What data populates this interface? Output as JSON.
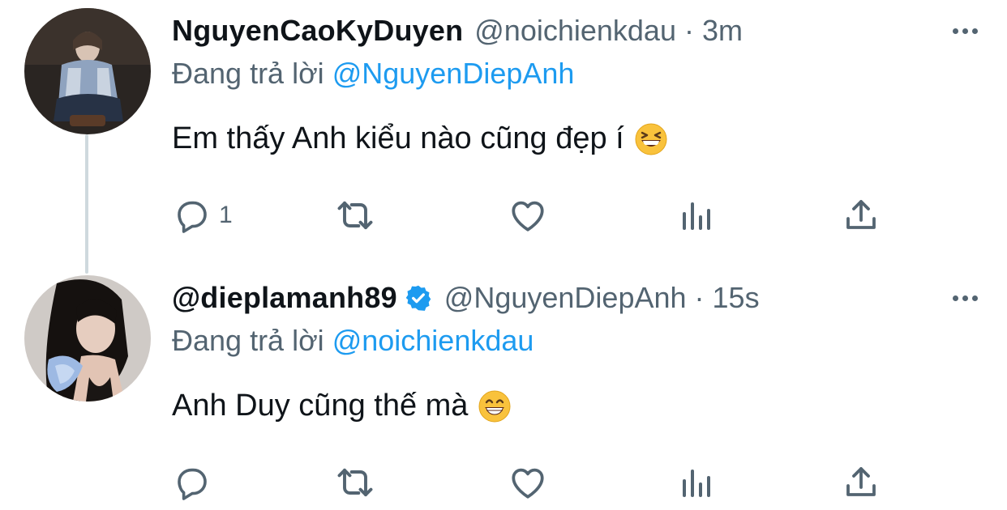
{
  "tweets": [
    {
      "display_name": "NguyenCaoKyDuyen",
      "handle": "@noichienkdau",
      "time": "3m",
      "separator": "·",
      "verified": false,
      "reply_prefix": "Đang trả lời",
      "reply_to": "@NguyenDiepAnh",
      "text": "Em thấy Anh kiểu nào cũng đẹp í",
      "emoji": "grinning-squinting-face",
      "reply_count": "1"
    },
    {
      "display_name": "@dieplamanh89",
      "handle": "@NguyenDiepAnh",
      "time": "15s",
      "separator": "·",
      "verified": true,
      "reply_prefix": "Đang trả lời",
      "reply_to": "@noichienkdau",
      "text": "Anh Duy cũng thế mà",
      "emoji": "beaming-face-with-smiling-eyes",
      "reply_count": ""
    }
  ],
  "icons": {
    "reply": "reply-icon",
    "retweet": "retweet-icon",
    "like": "heart-icon",
    "analytics": "analytics-icon",
    "share": "share-icon",
    "more": "more-icon",
    "verified": "verified-badge-icon"
  },
  "colors": {
    "text_primary": "#0f1419",
    "text_secondary": "#536471",
    "accent": "#1d9bf0",
    "thread_line": "#cfd9de"
  }
}
